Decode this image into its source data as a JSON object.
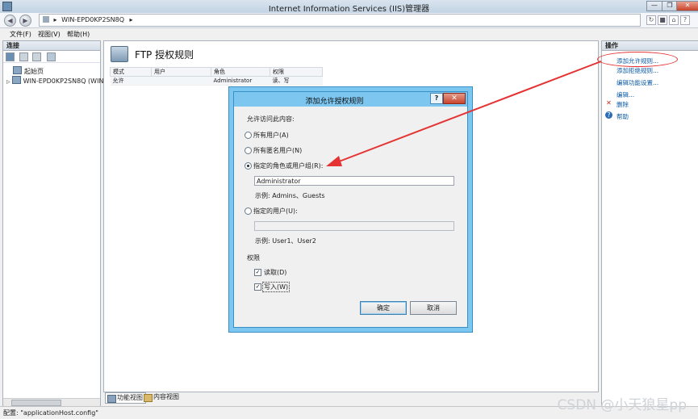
{
  "window": {
    "title": "Internet Information Services (IIS)管理器",
    "controls": {
      "minimize": "—",
      "restore": "❐",
      "close": "✕"
    }
  },
  "address": {
    "back": "◀",
    "forward": "▶",
    "path_arrow": "▸",
    "server": "WIN-EPD0KP2SN8Q",
    "separator": "▸"
  },
  "menu": {
    "file": "文件(F)",
    "view": "视图(V)",
    "help": "帮助(H)"
  },
  "connections": {
    "header": "连接",
    "items": [
      {
        "label": "起始页"
      },
      {
        "label": "WIN-EPD0KP2SN8Q (WIN-"
      }
    ]
  },
  "center": {
    "title": "FTP 授权规则",
    "table": {
      "headers": [
        "模式",
        "用户",
        "角色",
        "权限"
      ],
      "rows": [
        [
          "允许",
          "",
          "Administrator",
          "读、写"
        ]
      ]
    },
    "view_tabs": {
      "features": "功能视图",
      "content": "内容视图"
    }
  },
  "actions": {
    "header": "操作",
    "items": [
      {
        "label": "添加允许规则..."
      },
      {
        "label": "添加拒绝规则..."
      },
      {
        "label": "编辑功能设置..."
      },
      {
        "label": "编辑..."
      },
      {
        "label": "删除"
      },
      {
        "label": "帮助"
      }
    ]
  },
  "dialog": {
    "title": "添加允许授权规则",
    "help_button": "?",
    "close_button": "✕",
    "prompt": "允许访问此内容:",
    "options": {
      "all_users": "所有用户(A)",
      "anonymous": "所有匿名用户(N)",
      "roles": "指定的角色或用户组(R):",
      "users": "指定的用户(U):"
    },
    "selected": "roles",
    "roles_value": "Administrator",
    "roles_example": "示例: Admins、Guests",
    "users_value": "",
    "users_example": "示例: User1、User2",
    "permissions_label": "权限",
    "read": "读取(D)",
    "write": "写入(W)",
    "read_checked": true,
    "write_checked": true,
    "ok": "确定",
    "cancel": "取消"
  },
  "status": {
    "text": "配置: \"applicationHost.config\""
  },
  "watermark": "CSDN @小天狼星pp",
  "colors": {
    "accent": "#7cc6ef",
    "arrow": "#e53333",
    "link": "#0b5aa6"
  }
}
